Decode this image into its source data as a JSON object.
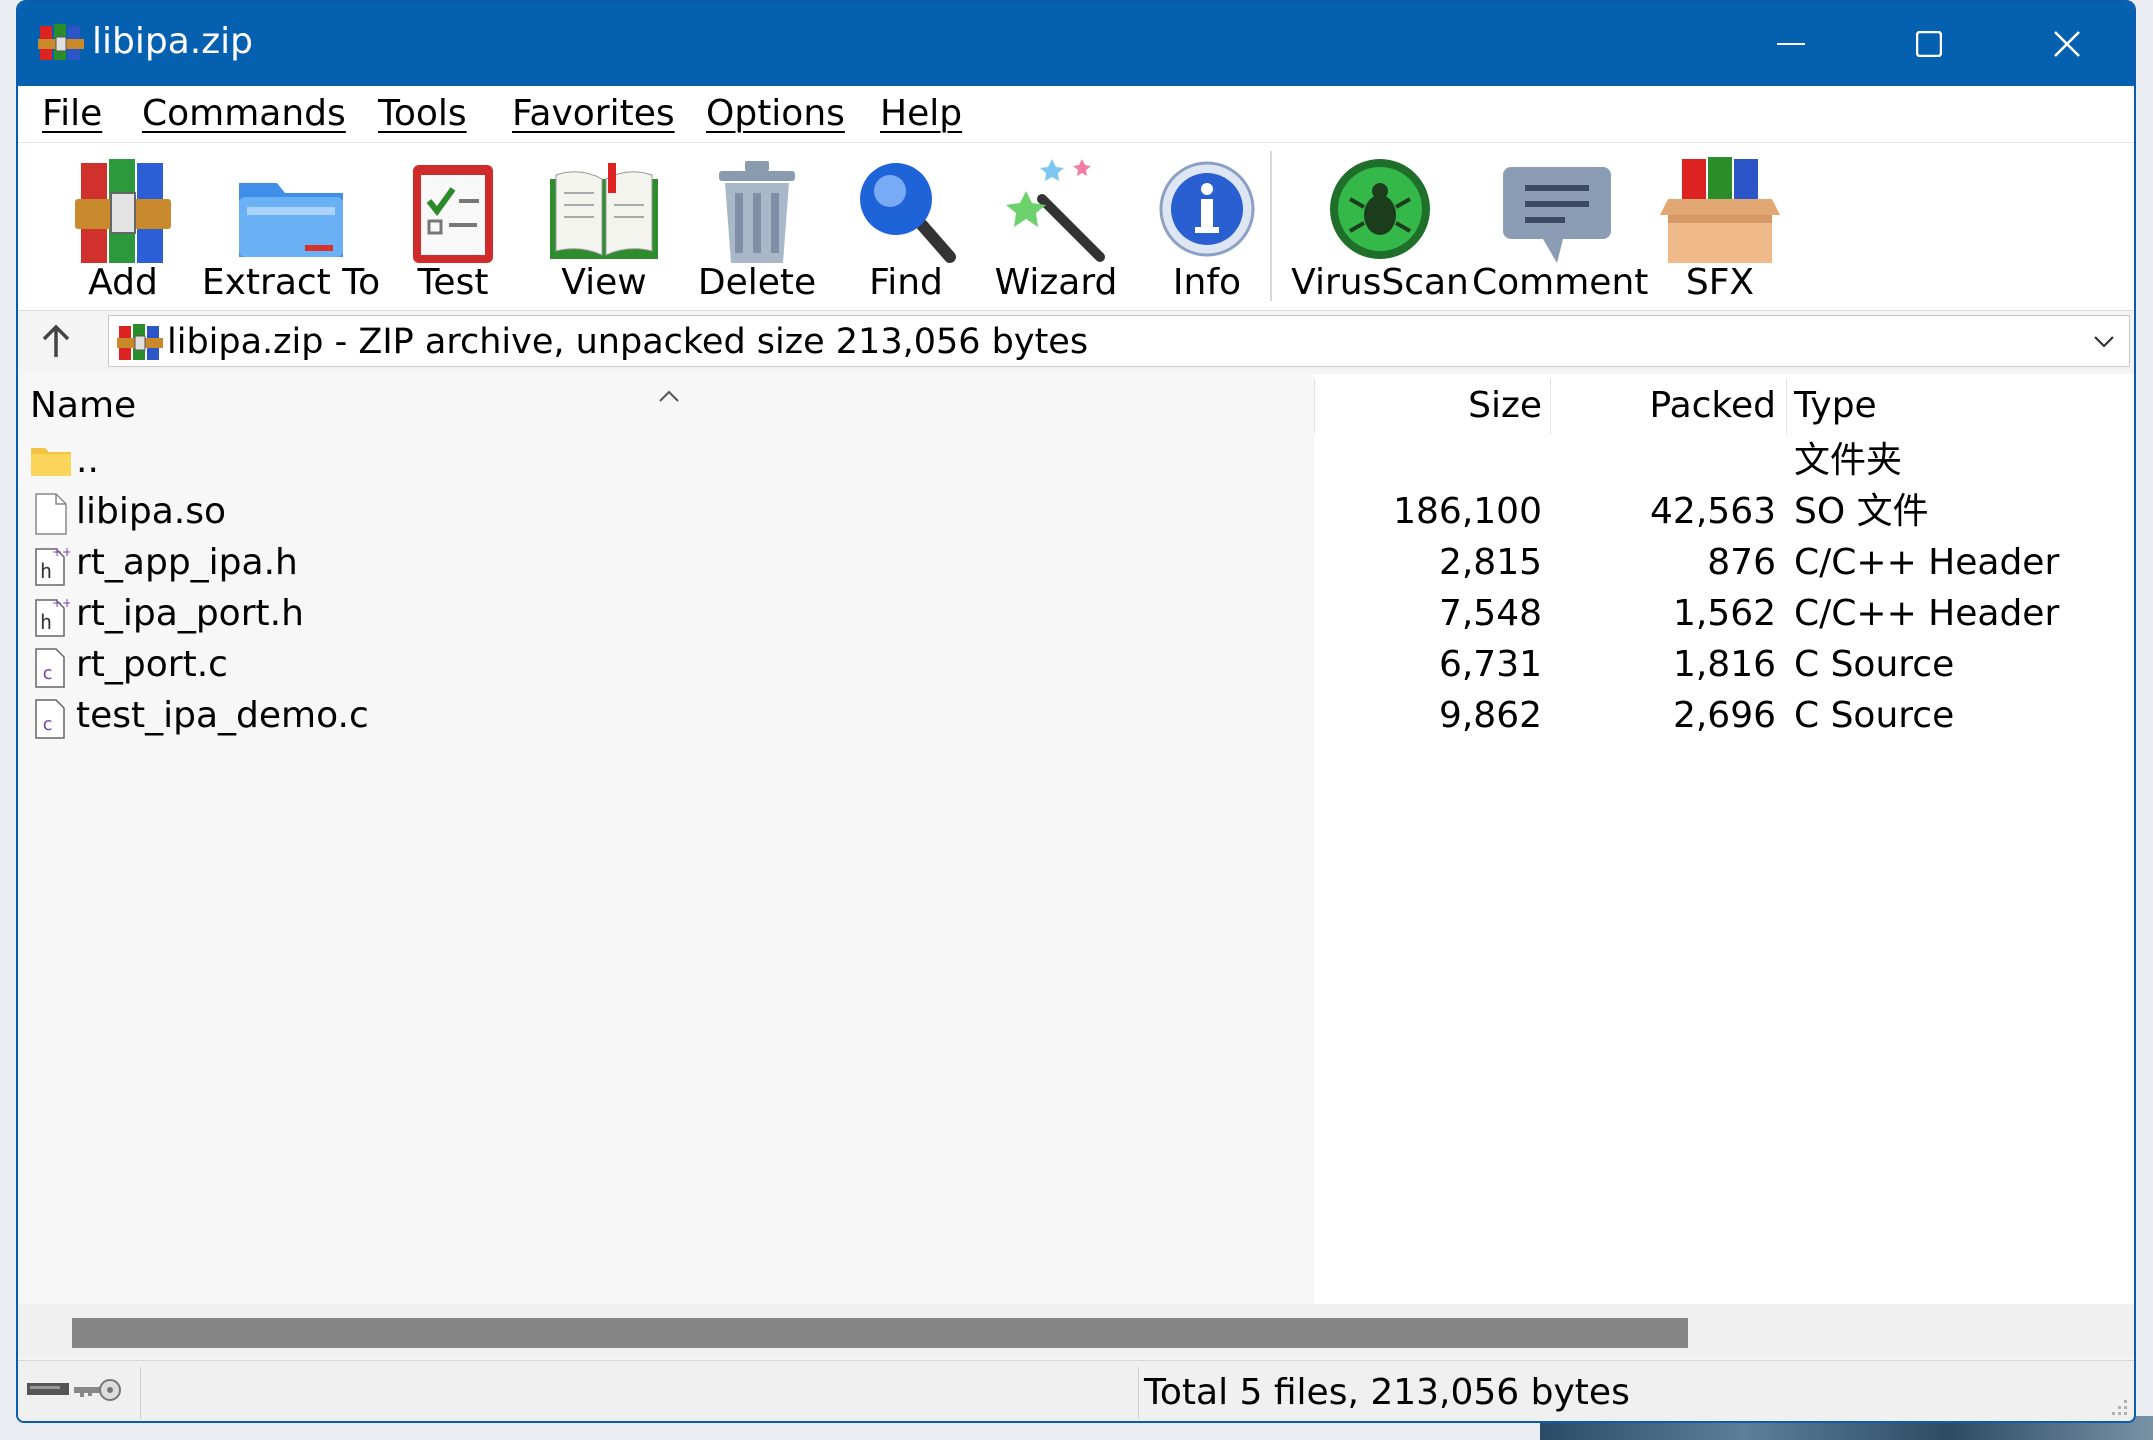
{
  "window": {
    "title": "libipa.zip",
    "accent": "#0560b0"
  },
  "menu": [
    {
      "label": "File"
    },
    {
      "label": "Commands"
    },
    {
      "label": "Tools"
    },
    {
      "label": "Favorites"
    },
    {
      "label": "Options"
    },
    {
      "label": "Help"
    }
  ],
  "toolbar": {
    "add": "Add",
    "extract": "Extract To",
    "test": "Test",
    "view": "View",
    "delete": "Delete",
    "find": "Find",
    "wizard": "Wizard",
    "info": "Info",
    "virusscan": "VirusScan",
    "comment": "Comment",
    "sfx": "SFX"
  },
  "address": {
    "text": "libipa.zip - ZIP archive, unpacked size 213,056 bytes"
  },
  "columns": {
    "name": "Name",
    "size": "Size",
    "packed": "Packed",
    "type": "Type"
  },
  "files": [
    {
      "name": "..",
      "size": "",
      "packed": "",
      "type": "文件夹",
      "icon": "folder-icon"
    },
    {
      "name": "libipa.so",
      "size": "186,100",
      "packed": "42,563",
      "type": "SO 文件",
      "icon": "blank-file-icon"
    },
    {
      "name": "rt_app_ipa.h",
      "size": "2,815",
      "packed": "876",
      "type": "C/C++ Header",
      "icon": "header-file-icon"
    },
    {
      "name": "rt_ipa_port.h",
      "size": "7,548",
      "packed": "1,562",
      "type": "C/C++ Header",
      "icon": "header-file-icon"
    },
    {
      "name": "rt_port.c",
      "size": "6,731",
      "packed": "1,816",
      "type": "C Source",
      "icon": "c-source-file-icon"
    },
    {
      "name": "test_ipa_demo.c",
      "size": "9,862",
      "packed": "2,696",
      "type": "C Source",
      "icon": "c-source-file-icon"
    }
  ],
  "status": {
    "text": "Total 5 files, 213,056 bytes"
  }
}
